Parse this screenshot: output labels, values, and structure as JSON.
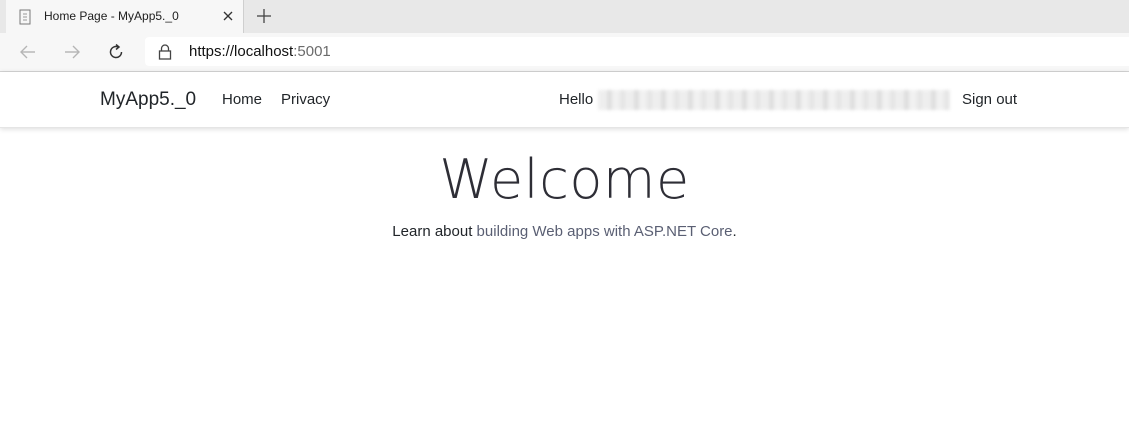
{
  "browser": {
    "tab_title": "Home Page - MyApp5._0",
    "url_host": "https://localhost",
    "url_rest": ":5001"
  },
  "site": {
    "brand": "MyApp5._0",
    "nav": {
      "home": "Home",
      "privacy": "Privacy"
    },
    "hello": "Hello",
    "sign_out": "Sign out"
  },
  "main": {
    "heading": "Welcome",
    "learn_prefix": "Learn about ",
    "learn_link": "building Web apps with ASP.NET Core",
    "learn_suffix": "."
  },
  "icons": {
    "favicon": "page-icon",
    "close": "close-icon",
    "new_tab": "plus-icon",
    "back": "back-arrow-icon",
    "forward": "forward-arrow-icon",
    "refresh": "refresh-icon",
    "lock": "lock-icon"
  }
}
